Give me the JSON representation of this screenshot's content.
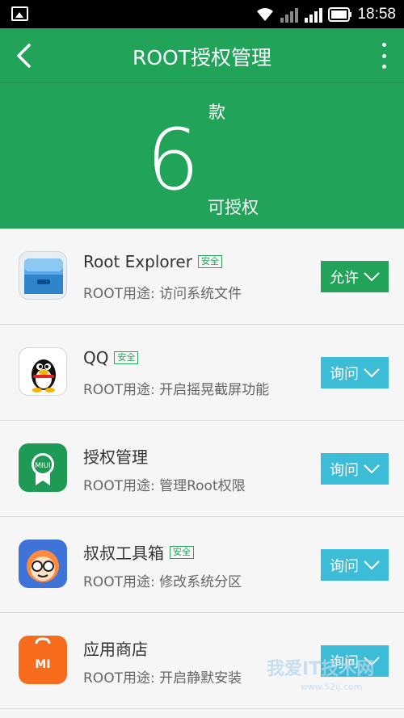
{
  "status_bar": {
    "time": "18:58"
  },
  "header": {
    "title": "ROOT授权管理"
  },
  "summary": {
    "unit": "款",
    "count": "6",
    "caption": "可授权"
  },
  "apps": [
    {
      "name": "Root Explorer",
      "safe_badge": "安全",
      "purpose": "ROOT用途: 访问系统文件",
      "permission": "允许"
    },
    {
      "name": "QQ",
      "safe_badge": "安全",
      "purpose": "ROOT用途: 开启摇晃截屏功能",
      "permission": "询问"
    },
    {
      "name": "授权管理",
      "safe_badge": "",
      "purpose": "ROOT用途: 管理Root权限",
      "permission": "询问"
    },
    {
      "name": "叔叔工具箱",
      "safe_badge": "安全",
      "purpose": "ROOT用途: 修改系统分区",
      "permission": "询问"
    },
    {
      "name": "应用商店",
      "safe_badge": "",
      "purpose": "ROOT用途: 开启静默安装",
      "permission": "询问"
    }
  ],
  "icons": {
    "app0": "file-manager-icon",
    "app1": "qq-penguin-icon",
    "app2": "miui-badge-icon",
    "app3": "toolbox-face-icon",
    "app4": "mi-store-icon",
    "app2_text": "MIUI",
    "app4_text": "MI"
  },
  "colors": {
    "header": "#21a35a",
    "allow": "#21a35a",
    "ask": "#3dbcd7"
  },
  "watermark": {
    "brand": "我爱IT技术网",
    "url": "www.52ij.com"
  }
}
